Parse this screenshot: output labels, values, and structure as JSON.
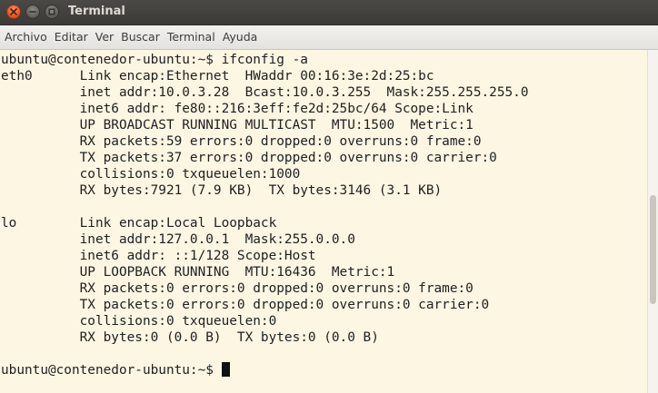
{
  "window": {
    "title": "Terminal"
  },
  "menubar": {
    "items": [
      "Archivo",
      "Editar",
      "Ver",
      "Buscar",
      "Terminal",
      "Ayuda"
    ]
  },
  "terminal": {
    "lines": [
      "ubuntu@contenedor-ubuntu:~$ ifconfig -a",
      "eth0      Link encap:Ethernet  HWaddr 00:16:3e:2d:25:bc",
      "          inet addr:10.0.3.28  Bcast:10.0.3.255  Mask:255.255.255.0",
      "          inet6 addr: fe80::216:3eff:fe2d:25bc/64 Scope:Link",
      "          UP BROADCAST RUNNING MULTICAST  MTU:1500  Metric:1",
      "          RX packets:59 errors:0 dropped:0 overruns:0 frame:0",
      "          TX packets:37 errors:0 dropped:0 overruns:0 carrier:0",
      "          collisions:0 txqueuelen:1000",
      "          RX bytes:7921 (7.9 KB)  TX bytes:3146 (3.1 KB)",
      "",
      "lo        Link encap:Local Loopback",
      "          inet addr:127.0.0.1  Mask:255.0.0.0",
      "          inet6 addr: ::1/128 Scope:Host",
      "          UP LOOPBACK RUNNING  MTU:16436  Metric:1",
      "          RX packets:0 errors:0 dropped:0 overruns:0 frame:0",
      "          TX packets:0 errors:0 dropped:0 overruns:0 carrier:0",
      "          collisions:0 txqueuelen:0",
      "          RX bytes:0 (0.0 B)  TX bytes:0 (0.0 B)",
      "",
      "ubuntu@contenedor-ubuntu:~$ "
    ],
    "prompt_line_index": 19
  },
  "colors": {
    "terminal_bg": "#fdf6e3",
    "terminal_fg": "#1f1f1f",
    "titlebar_bg": "#3c3b37",
    "close_button": "#e0531e"
  },
  "icons": {
    "close": "close-icon",
    "minimize": "minimize-icon",
    "maximize": "maximize-icon",
    "cursor": "block-cursor"
  }
}
